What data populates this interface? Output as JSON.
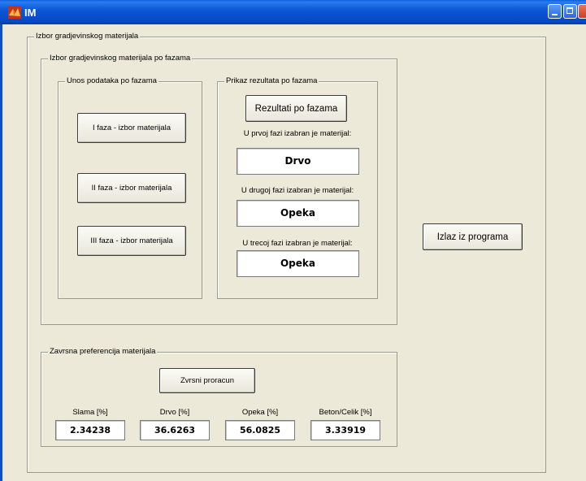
{
  "window": {
    "title": "IM"
  },
  "outer_panel": {
    "title": "Izbor gradjevinskog materijala"
  },
  "phase_panel": {
    "title": "Izbor gradjevinskog materijala po fazama"
  },
  "input_panel": {
    "title": "Unos podataka po fazama",
    "buttons": [
      "I faza - izbor materijala",
      "II faza - izbor materijala",
      "III faza - izbor materijala"
    ]
  },
  "results_panel": {
    "title": "Prikaz rezultata po fazama",
    "button_label": "Rezultati po fazama",
    "phases": [
      {
        "label": "U prvoj fazi izabran je materijal:",
        "value": "Drvo"
      },
      {
        "label": "U drugoj fazi izabran je materijal:",
        "value": "Opeka"
      },
      {
        "label": "U trecoj fazi izabran je materijal:",
        "value": "Opeka"
      }
    ]
  },
  "exit_button": {
    "label": "Izlaz iz programa"
  },
  "final_panel": {
    "title": "Zavrsna preferencija materijala",
    "button_label": "Zvrsni proracun",
    "columns": [
      {
        "label": "Slama [%]",
        "value": "2.34238"
      },
      {
        "label": "Drvo [%]",
        "value": "36.6263"
      },
      {
        "label": "Opeka [%]",
        "value": "56.0825"
      },
      {
        "label": "Beton/Celik [%]",
        "value": "3.33919"
      }
    ]
  },
  "colors": {
    "titlebar": "#0b57d6",
    "background": "#ece9d8",
    "close_button": "#c8401f"
  },
  "icons": {
    "app": "matlab-icon"
  }
}
